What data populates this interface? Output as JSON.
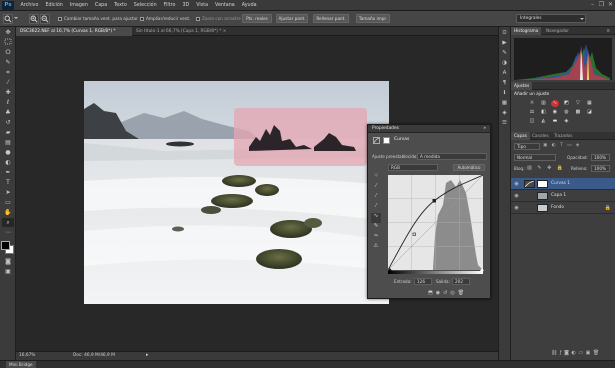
{
  "menubar": {
    "logo": "Ps",
    "items": [
      "Archivo",
      "Edición",
      "Imagen",
      "Capa",
      "Texto",
      "Selección",
      "Filtro",
      "3D",
      "Vista",
      "Ventana",
      "Ayuda"
    ],
    "minimize": "–",
    "restore": "❐",
    "close": "✕"
  },
  "options": {
    "resize_windows_label": "Cambiar tamaño vent. para ajustar",
    "zoom_all_label": "Ampliar/reducir vent.",
    "scrubby_zoom_label": "Zoom con arrastre",
    "actual_pixels": "Pts. reales",
    "fit_screen": "Ajustar pant.",
    "fill_screen": "Rellenar pant.",
    "print_size": "Tamaño impr.",
    "workspace": "Integrales"
  },
  "tabs": [
    {
      "label": "DSC3622.NEF al 16,7% (Curvas 1, RGB/8*) *",
      "close": "×"
    },
    {
      "label": "Sin título-1 al 66,7% (Capa 1, RGB/8*) *",
      "close": "×"
    }
  ],
  "properties": {
    "title": "Propiedades",
    "header": "Curvas",
    "preset_label": "Ajuste preestablecido:",
    "preset_value": "A medida",
    "channel": "RGB",
    "auto_button": "Automático",
    "input_label": "Entrada:",
    "input_value": "126",
    "output_label": "Salida:",
    "output_value": "202"
  },
  "histogram": {
    "tabs": [
      "Histograma",
      "Navegador"
    ]
  },
  "adjustments": {
    "tabs": [
      "Ajustes"
    ],
    "add_label": "Añadir un ajuste"
  },
  "layers": {
    "tabs": [
      "Capas",
      "Canales",
      "Trazados"
    ],
    "filter_kind": "Tipo",
    "blend_mode": "Normal",
    "opacity_label": "Opacidad:",
    "opacity_value": "100%",
    "lock_label": "Bloq.:",
    "fill_label": "Relleno:",
    "fill_value": "100%",
    "items": [
      {
        "name": "Curvas 1",
        "selected": true
      },
      {
        "name": "Capa 1",
        "selected": false
      },
      {
        "name": "Fondo",
        "selected": false
      }
    ]
  },
  "status": {
    "zoom": "16,67%",
    "doc_info": "Doc: 46,9 M/46,9 M"
  },
  "mini_bridge": {
    "label": "Mini Bridge"
  }
}
